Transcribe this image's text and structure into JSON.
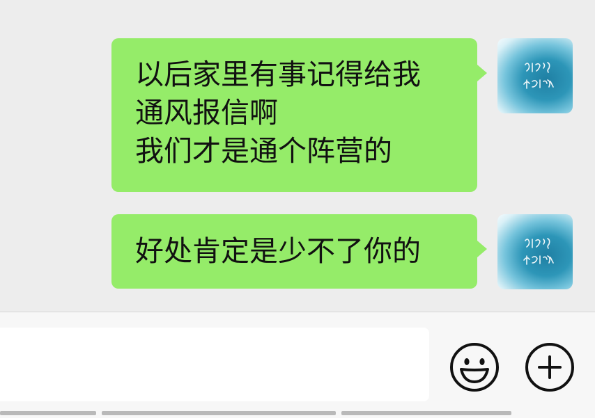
{
  "messages": [
    {
      "sender": "self",
      "lines": [
        "以后家里有事记得给我",
        "通风报信啊",
        "我们才是通个阵营的"
      ]
    },
    {
      "sender": "self",
      "lines": [
        "好处肯定是少不了你的"
      ]
    }
  ],
  "avatar": {
    "icon": "sky-calligraphy-avatar"
  },
  "input_bar": {
    "emoji_icon": "smiley-face-icon",
    "plus_icon": "circle-plus-icon"
  },
  "colors": {
    "chat_background": "#ededed",
    "bubble": "#95ec69",
    "input_bar": "#f7f7f7",
    "icon_stroke": "#111111"
  }
}
